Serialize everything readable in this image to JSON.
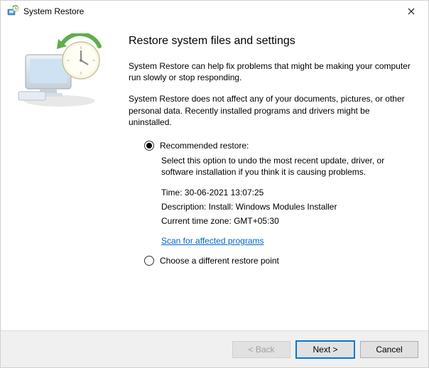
{
  "titlebar": {
    "title": "System Restore"
  },
  "main": {
    "heading": "Restore system files and settings",
    "intro1": "System Restore can help fix problems that might be making your computer run slowly or stop responding.",
    "intro2": "System Restore does not affect any of your documents, pictures, or other personal data. Recently installed programs and drivers might be uninstalled.",
    "option_recommended": {
      "label": "Recommended restore:",
      "description": "Select this option to undo the most recent update, driver, or software installation if you think it is causing problems.",
      "time_label": "Time:",
      "time_value": "30-06-2021 13:07:25",
      "desc_label": "Description:",
      "desc_value": "Install: Windows Modules Installer",
      "tz_label": "Current time zone:",
      "tz_value": "GMT+05:30",
      "scan_link": "Scan for affected programs"
    },
    "option_choose": {
      "label": "Choose a different restore point"
    }
  },
  "footer": {
    "back": "< Back",
    "next": "Next >",
    "cancel": "Cancel"
  }
}
